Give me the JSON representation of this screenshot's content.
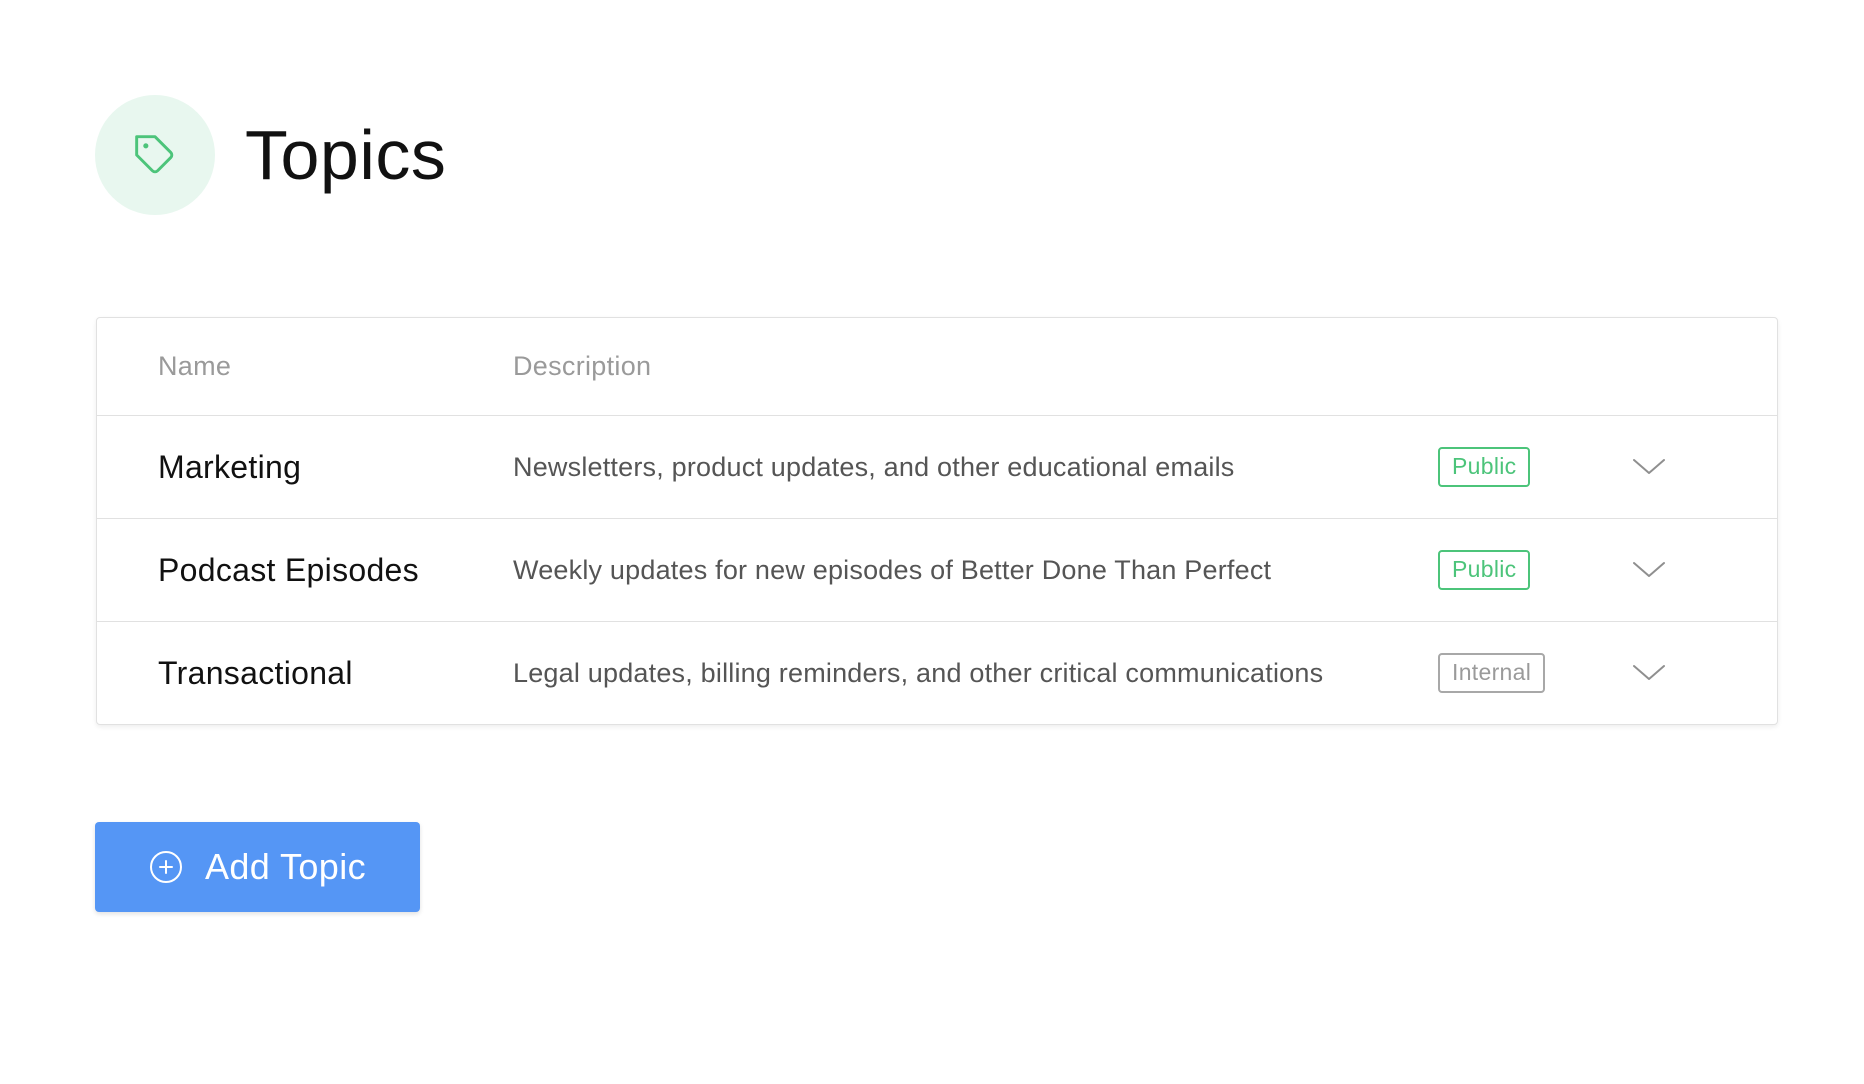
{
  "header": {
    "title": "Topics",
    "icon": "tag-icon",
    "icon_color": "#4cc47a",
    "icon_bg": "#e8f7ef"
  },
  "table": {
    "columns": {
      "name": "Name",
      "description": "Description"
    },
    "rows": [
      {
        "name": "Marketing",
        "description": "Newsletters, product updates, and other educational emails",
        "visibility": "Public"
      },
      {
        "name": "Podcast Episodes",
        "description": "Weekly updates for new episodes of Better Done Than Perfect",
        "visibility": "Public"
      },
      {
        "name": "Transactional",
        "description": "Legal updates, billing reminders, and other critical communications",
        "visibility": "Internal"
      }
    ]
  },
  "actions": {
    "add_label": "Add Topic",
    "add_icon": "plus-circle-icon",
    "button_color": "#5596f5"
  },
  "colors": {
    "public_badge": "#4cc47a",
    "internal_badge": "#9a9a9a"
  }
}
